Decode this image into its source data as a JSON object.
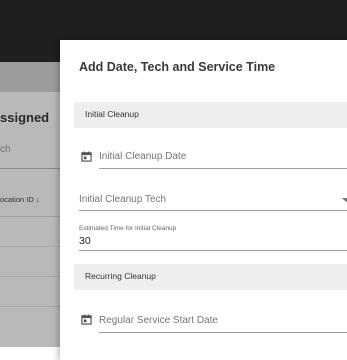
{
  "background": {
    "page_title_partial": "ssigned",
    "search_placeholder_partial": "ch",
    "column_header_partial": "ocation ID ↓"
  },
  "dialog": {
    "title": "Add Date, Tech and Service Time",
    "sections": {
      "initial": "Initial Cleanup",
      "recurring": "Recurring Cleanup"
    },
    "fields": {
      "initial_date_placeholder": "Initial Cleanup Date",
      "initial_tech_placeholder": "Initial Cleanup Tech",
      "estimated_time_label": "Estimated Time for Initial Cleanup",
      "estimated_time_value": "30",
      "regular_start_placeholder": "Regular Service Start Date"
    }
  },
  "icons": {
    "calendar": "calendar-icon",
    "dropdown": "chevron-down-icon"
  }
}
